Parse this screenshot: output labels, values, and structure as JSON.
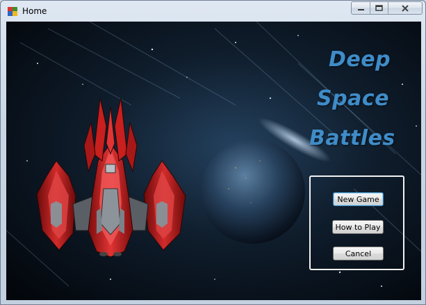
{
  "window": {
    "title": "Home",
    "icon": "app-window-icon",
    "controls": [
      "minimize-icon",
      "maximize-icon",
      "close-icon"
    ]
  },
  "hero": {
    "title_lines": [
      "Deep",
      "Space",
      "Battles"
    ],
    "title_color": "#3f8cc8",
    "image": "red-spaceship"
  },
  "menu": {
    "new_game": "New Game",
    "how_to_play": "How to Play",
    "cancel": "Cancel"
  }
}
